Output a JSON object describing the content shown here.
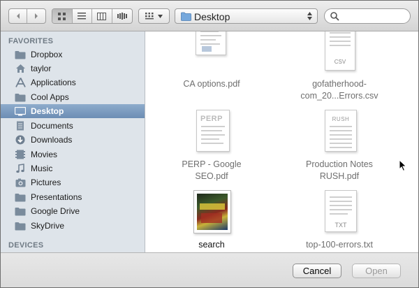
{
  "toolbar": {
    "back_icon": "chevron-left",
    "forward_icon": "chevron-right",
    "view_modes": [
      "icon-view",
      "list-view",
      "column-view",
      "coverflow-view"
    ],
    "arrange_icon": "arrange-grid",
    "location": "Desktop",
    "search_placeholder": ""
  },
  "sidebar": {
    "favorites_header": "FAVORITES",
    "devices_header": "DEVICES",
    "items": [
      {
        "label": "Dropbox",
        "icon": "folder-icon"
      },
      {
        "label": "taylor",
        "icon": "home-icon"
      },
      {
        "label": "Applications",
        "icon": "applications-icon"
      },
      {
        "label": "Cool Apps",
        "icon": "folder-icon"
      },
      {
        "label": "Desktop",
        "icon": "desktop-icon",
        "selected": true
      },
      {
        "label": "Documents",
        "icon": "documents-icon"
      },
      {
        "label": "Downloads",
        "icon": "downloads-icon"
      },
      {
        "label": "Movies",
        "icon": "movies-icon"
      },
      {
        "label": "Music",
        "icon": "music-icon"
      },
      {
        "label": "Pictures",
        "icon": "pictures-icon"
      },
      {
        "label": "Presentations",
        "icon": "folder-icon"
      },
      {
        "label": "Google Drive",
        "icon": "folder-icon"
      },
      {
        "label": "SkyDrive",
        "icon": "folder-icon"
      }
    ]
  },
  "files": [
    {
      "line1": "CA options.pdf",
      "line2": "",
      "dimmed": true
    },
    {
      "line1": "gofatherhood-",
      "line2": "com_20...Errors.csv",
      "dimmed": true,
      "badge": "CSV"
    },
    {
      "line1": "PERP - Google",
      "line2": "SEO.pdf",
      "dimmed": true,
      "badge": "PERP"
    },
    {
      "line1": "Production Notes",
      "line2": "RUSH.pdf",
      "dimmed": true,
      "badge": "RUSH"
    },
    {
      "line1": "search",
      "line2": "",
      "dimmed": false
    },
    {
      "line1": "top-100-errors.txt",
      "line2": "",
      "dimmed": true,
      "badge": "TXT"
    }
  ],
  "buttons": {
    "cancel": "Cancel",
    "open": "Open"
  },
  "colors": {
    "sidebar_bg": "#dee4ea",
    "selection": "#7394bb",
    "folder_blue": "#6fa2d8"
  }
}
